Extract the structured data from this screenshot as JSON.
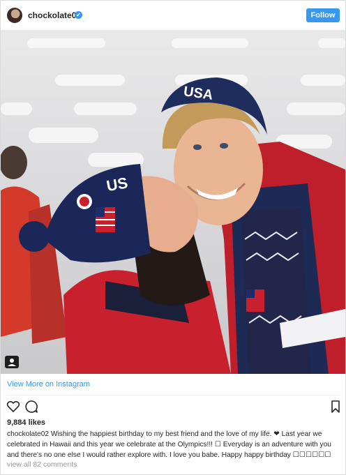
{
  "header": {
    "username": "chockolate02",
    "verified_mark": "✔",
    "follow_label": "Follow"
  },
  "post": {
    "view_more_label": "View More on Instagram",
    "likes": "9,884 likes",
    "caption_username": "chockolate02",
    "caption_text": "Wishing the happiest birthday to my best friend and the love of my life. ❤ Last year we celebrated in Hawaii and this year we celebrate at the Olympics!!! ☐ Everyday is an adventure with you and there's no one else I would rather explore with. I love you babe. Happy happy birthday ☐☐☐☐☐☐",
    "view_comments": "view all 82 comments"
  },
  "icons": {
    "like": "heart-icon",
    "comment": "comment-icon",
    "save": "bookmark-icon",
    "tag": "user-tag-icon"
  },
  "colors": {
    "accent": "#3897f0",
    "text": "#262626",
    "muted": "#999999"
  }
}
